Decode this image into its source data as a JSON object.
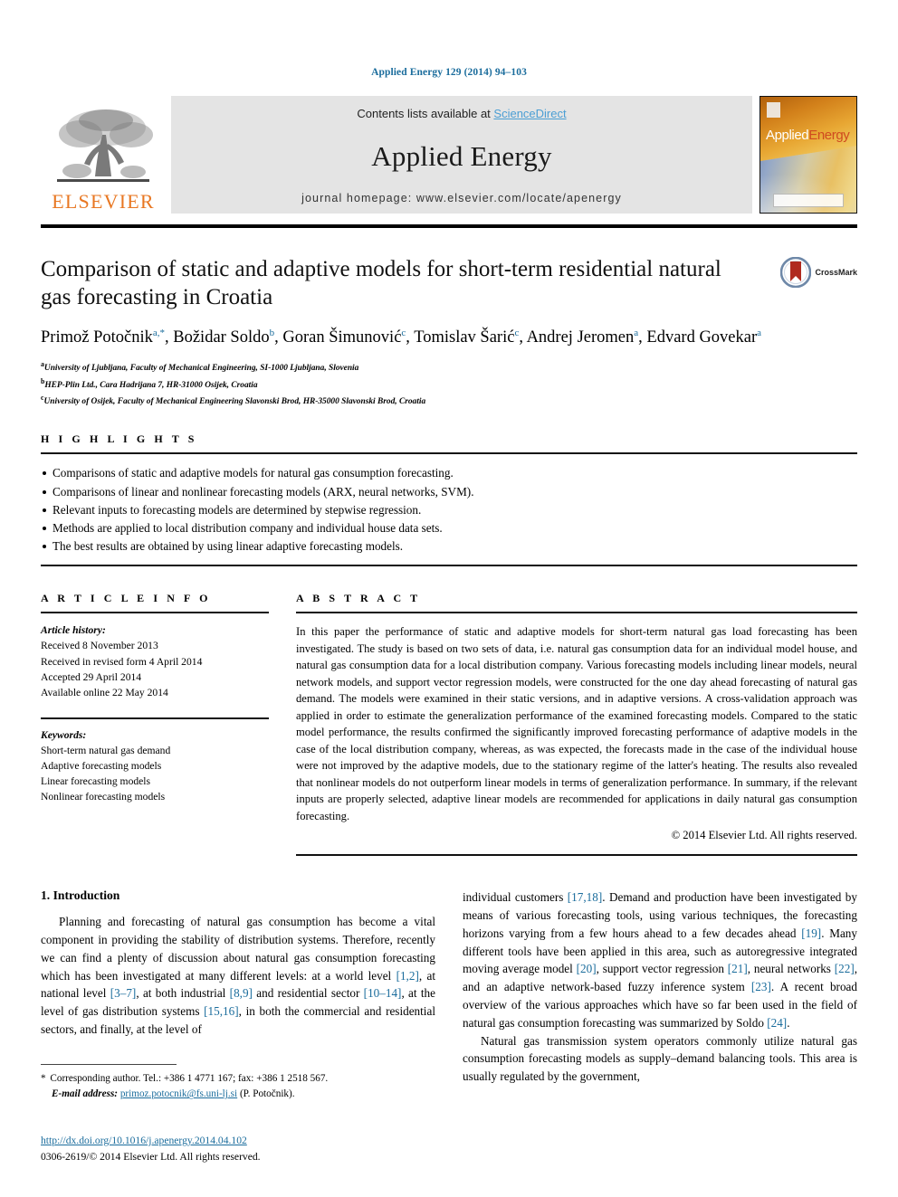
{
  "running_head": "Applied Energy 129 (2014) 94–103",
  "masthead": {
    "publisher_name": "ELSEVIER",
    "contents_prefix": "Contents lists available at ",
    "contents_link": "ScienceDirect",
    "journal_name": "Applied Energy",
    "homepage": "journal homepage: www.elsevier.com/locate/apenergy",
    "cover_title_part1": "Applied",
    "cover_title_part2": "Energy"
  },
  "article": {
    "title": "Comparison of static and adaptive models for short-term residential natural gas forecasting in Croatia",
    "crossmark_label": "CrossMark",
    "authors_html": "Primož Potočnik<sup>a,*</sup>, Božidar Soldo<sup>b</sup>, Goran Šimunović<sup>c</sup>, Tomislav Šarić<sup>c</sup>, Andrej Jeromen<sup>a</sup>, Edvard Govekar<sup>a</sup>",
    "affiliations": [
      {
        "marker": "a",
        "text": "University of Ljubljana, Faculty of Mechanical Engineering, SI-1000 Ljubljana, Slovenia"
      },
      {
        "marker": "b",
        "text": "HEP-Plin Ltd., Cara Hadrijana 7, HR-31000 Osijek, Croatia"
      },
      {
        "marker": "c",
        "text": "University of Osijek, Faculty of Mechanical Engineering Slavonski Brod, HR-35000 Slavonski Brod, Croatia"
      }
    ]
  },
  "highlights": {
    "heading": "H I G H L I G H T S",
    "items": [
      "Comparisons of static and adaptive models for natural gas consumption forecasting.",
      "Comparisons of linear and nonlinear forecasting models (ARX, neural networks, SVM).",
      "Relevant inputs to forecasting models are determined by stepwise regression.",
      "Methods are applied to local distribution company and individual house data sets.",
      "The best results are obtained by using linear adaptive forecasting models."
    ]
  },
  "article_info": {
    "heading": "A R T I C L E    I N F O",
    "history_label": "Article history:",
    "history": [
      "Received 8 November 2013",
      "Received in revised form 4 April 2014",
      "Accepted 29 April 2014",
      "Available online 22 May 2014"
    ],
    "keywords_label": "Keywords:",
    "keywords": [
      "Short-term natural gas demand",
      "Adaptive forecasting models",
      "Linear forecasting models",
      "Nonlinear forecasting models"
    ]
  },
  "abstract": {
    "heading": "A B S T R A C T",
    "text": "In this paper the performance of static and adaptive models for short-term natural gas load forecasting has been investigated. The study is based on two sets of data, i.e. natural gas consumption data for an individual model house, and natural gas consumption data for a local distribution company. Various forecasting models including linear models, neural network models, and support vector regression models, were constructed for the one day ahead forecasting of natural gas demand. The models were examined in their static versions, and in adaptive versions. A cross-validation approach was applied in order to estimate the generalization performance of the examined forecasting models. Compared to the static model performance, the results confirmed the significantly improved forecasting performance of adaptive models in the case of the local distribution company, whereas, as was expected, the forecasts made in the case of the individual house were not improved by the adaptive models, due to the stationary regime of the latter's heating. The results also revealed that nonlinear models do not outperform linear models in terms of generalization performance. In summary, if the relevant inputs are properly selected, adaptive linear models are recommended for applications in daily natural gas consumption forecasting.",
    "copyright": "© 2014 Elsevier Ltd. All rights reserved."
  },
  "introduction": {
    "heading": "1. Introduction",
    "left_paragraph_html": "Planning and forecasting of natural gas consumption has become a vital component in providing the stability of distribution systems. Therefore, recently we can find a plenty of discussion about natural gas consumption forecasting which has been investigated at many different levels: at a world level <span class=\"ref\">[1,2]</span>, at national level <span class=\"ref\">[3–7]</span>, at both industrial <span class=\"ref\">[8,9]</span> and residential sector <span class=\"ref\">[10–14]</span>, at the level of gas distribution systems <span class=\"ref\">[15,16]</span>, in both the commercial and residential sectors, and finally, at the level of",
    "right_paragraph_1_html": "individual customers <span class=\"ref\">[17,18]</span>. Demand and production have been investigated by means of various forecasting tools, using various techniques, the forecasting horizons varying from a few hours ahead to a few decades ahead <span class=\"ref\">[19]</span>. Many different tools have been applied in this area, such as autoregressive integrated moving average model <span class=\"ref\">[20]</span>, support vector regression <span class=\"ref\">[21]</span>, neural networks <span class=\"ref\">[22]</span>, and an adaptive network-based fuzzy inference system <span class=\"ref\">[23]</span>. A recent broad overview of the various approaches which have so far been used in the field of natural gas consumption forecasting was summarized by Soldo <span class=\"ref\">[24]</span>.",
    "right_paragraph_2_html": "Natural gas transmission system operators commonly utilize natural gas consumption forecasting models as supply–demand balancing tools. This area is usually regulated by the government,"
  },
  "footnote": {
    "corresponding_html": "<span class=\"star\">*</span> Corresponding author. Tel.: +386 1 4771 167; fax: +386 1 2518 567.",
    "email_label": "E-mail address:",
    "email": "primoz.potocnik@fs.uni-lj.si",
    "email_suffix": "(P. Potočnik)."
  },
  "doi": {
    "url": "http://dx.doi.org/10.1016/j.apenergy.2014.04.102",
    "issn_line": "0306-2619/© 2014 Elsevier Ltd. All rights reserved."
  },
  "colors": {
    "link_blue": "#1a6c9c",
    "sciencedirect_blue": "#4a9ed4",
    "elsevier_orange": "#E87722"
  }
}
